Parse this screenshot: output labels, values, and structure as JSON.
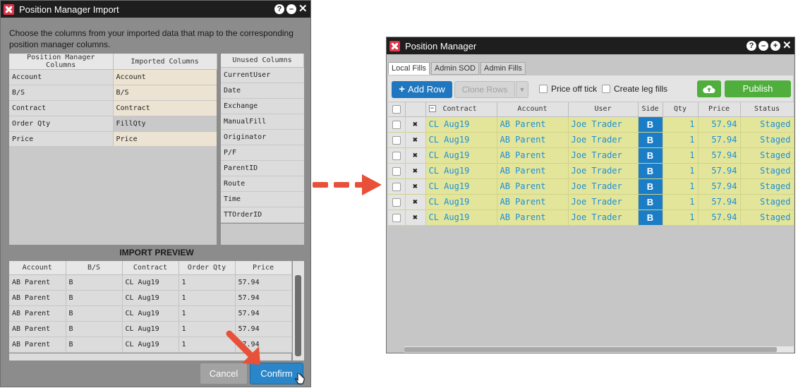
{
  "import_dialog": {
    "title": "Position Manager Import",
    "controls": {
      "help": "?",
      "minimize": "–",
      "close": "✕"
    },
    "instruction": "Choose the columns from your imported data that map to the corresponding position manager columns.",
    "mapping": {
      "headers": [
        "Position Manager Columns",
        "Imported Columns"
      ],
      "rows": [
        [
          "Account",
          "Account"
        ],
        [
          "B/S",
          "B/S"
        ],
        [
          "Contract",
          "Contract"
        ],
        [
          "Order Qty",
          "FillQty"
        ],
        [
          "Price",
          "Price"
        ]
      ]
    },
    "unused": {
      "header": "Unused Columns",
      "items": [
        "CurrentUser",
        "Date",
        "Exchange",
        "ManualFill",
        "Originator",
        "P/F",
        "ParentID",
        "Route",
        "Time",
        "TTOrderID"
      ]
    },
    "preview": {
      "title": "IMPORT PREVIEW",
      "headers": [
        "Account",
        "B/S",
        "Contract",
        "Order Qty",
        "Price"
      ],
      "rows": [
        [
          "AB Parent",
          "B",
          "CL Aug19",
          "1",
          "57.94"
        ],
        [
          "AB Parent",
          "B",
          "CL Aug19",
          "1",
          "57.94"
        ],
        [
          "AB Parent",
          "B",
          "CL Aug19",
          "1",
          "57.94"
        ],
        [
          "AB Parent",
          "B",
          "CL Aug19",
          "1",
          "57.94"
        ],
        [
          "AB Parent",
          "B",
          "CL Aug19",
          "1",
          "57.94"
        ]
      ]
    },
    "cancel_label": "Cancel",
    "confirm_label": "Confirm"
  },
  "position_manager": {
    "title": "Position Manager",
    "controls": {
      "help": "?",
      "minimize": "–",
      "maximize": "+",
      "close": "✕"
    },
    "tabs": [
      "Local Fills",
      "Admin SOD",
      "Admin Fills"
    ],
    "toolbar": {
      "add_row": "Add Row",
      "clone_rows": "Clone Rows",
      "price_off_tick": "Price off tick",
      "create_leg_fills": "Create leg fills",
      "publish": "Publish"
    },
    "columns": [
      "Contract",
      "Account",
      "User",
      "Side",
      "Qty",
      "Price",
      "Status"
    ],
    "rows": [
      {
        "contract": "CL Aug19",
        "account": "AB Parent",
        "user": "Joe Trader",
        "side": "B",
        "qty": "1",
        "price": "57.94",
        "status": "Staged"
      },
      {
        "contract": "CL Aug19",
        "account": "AB Parent",
        "user": "Joe Trader",
        "side": "B",
        "qty": "1",
        "price": "57.94",
        "status": "Staged"
      },
      {
        "contract": "CL Aug19",
        "account": "AB Parent",
        "user": "Joe Trader",
        "side": "B",
        "qty": "1",
        "price": "57.94",
        "status": "Staged"
      },
      {
        "contract": "CL Aug19",
        "account": "AB Parent",
        "user": "Joe Trader",
        "side": "B",
        "qty": "1",
        "price": "57.94",
        "status": "Staged"
      },
      {
        "contract": "CL Aug19",
        "account": "AB Parent",
        "user": "Joe Trader",
        "side": "B",
        "qty": "1",
        "price": "57.94",
        "status": "Staged"
      },
      {
        "contract": "CL Aug19",
        "account": "AB Parent",
        "user": "Joe Trader",
        "side": "B",
        "qty": "1",
        "price": "57.94",
        "status": "Staged"
      },
      {
        "contract": "CL Aug19",
        "account": "AB Parent",
        "user": "Joe Trader",
        "side": "B",
        "qty": "1",
        "price": "57.94",
        "status": "Staged"
      }
    ]
  },
  "colors": {
    "accent_blue": "#2a86c8",
    "publish_green": "#4fae3c",
    "staged_row": "#e3e69a",
    "annotation_red": "#e8503a"
  }
}
